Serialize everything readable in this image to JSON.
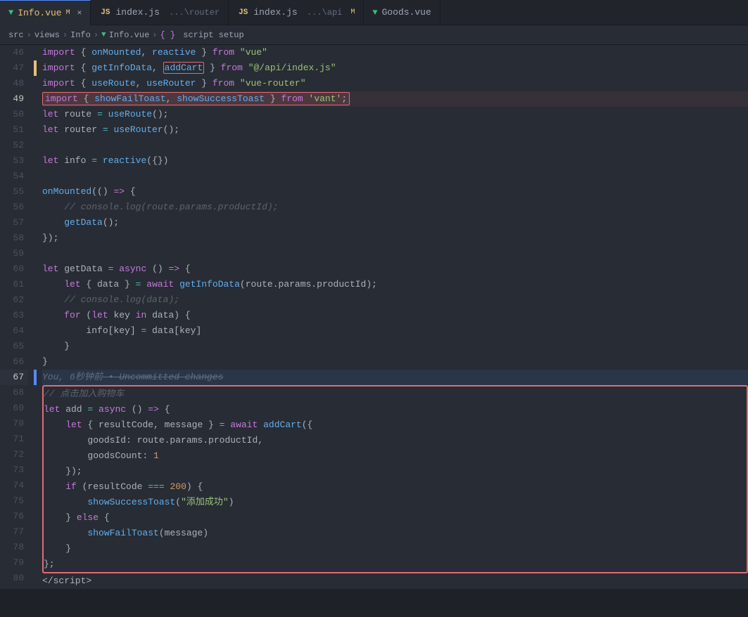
{
  "tabs": [
    {
      "id": "info-vue",
      "icon": "vue",
      "label": "Info.vue",
      "modified": true,
      "active": true,
      "close": true
    },
    {
      "id": "router-index",
      "icon": "js",
      "label": "index.js",
      "path": "...\\router",
      "active": false
    },
    {
      "id": "api-index",
      "icon": "js",
      "label": "index.js",
      "path": "...\\api",
      "modified": true,
      "active": false
    },
    {
      "id": "goods-vue",
      "icon": "vue",
      "label": "Goods.vue",
      "active": false
    }
  ],
  "breadcrumb": {
    "parts": [
      "src",
      "views",
      "Info",
      "Info.vue",
      "{ } script setup"
    ]
  },
  "lines": [
    {
      "num": 46,
      "git": "",
      "content": "46_import_onMounted"
    },
    {
      "num": 47,
      "git": "modified",
      "content": "47_import_getInfoData"
    },
    {
      "num": 48,
      "git": "",
      "content": "48_import_useRoute"
    },
    {
      "num": 49,
      "git": "",
      "content": "49_import_showFail",
      "highlight": true
    },
    {
      "num": 50,
      "git": "",
      "content": "50_let_route"
    },
    {
      "num": 51,
      "git": "",
      "content": "51_let_router"
    },
    {
      "num": 52,
      "git": "",
      "content": "52_blank"
    },
    {
      "num": 53,
      "git": "",
      "content": "53_let_info"
    },
    {
      "num": 54,
      "git": "",
      "content": "54_blank"
    },
    {
      "num": 55,
      "git": "",
      "content": "55_onMounted"
    },
    {
      "num": 56,
      "git": "",
      "content": "56_console_log"
    },
    {
      "num": 57,
      "git": "",
      "content": "57_getData"
    },
    {
      "num": 58,
      "git": "",
      "content": "58_close_mounted"
    },
    {
      "num": 59,
      "git": "",
      "content": "59_blank"
    },
    {
      "num": 60,
      "git": "",
      "content": "60_let_getData"
    },
    {
      "num": 61,
      "git": "",
      "content": "61_let_data"
    },
    {
      "num": 62,
      "git": "",
      "content": "62_console_log_data"
    },
    {
      "num": 63,
      "git": "",
      "content": "63_for_let"
    },
    {
      "num": 64,
      "git": "",
      "content": "64_info_key"
    },
    {
      "num": 65,
      "git": "",
      "content": "65_close_brace"
    },
    {
      "num": 66,
      "git": "",
      "content": "66_close_brace2"
    },
    {
      "num": 67,
      "git": "blue",
      "content": "67_you_uncommitted"
    },
    {
      "num": 68,
      "git": "",
      "content": "68_comment_add_cart",
      "redBorder": true
    },
    {
      "num": 69,
      "git": "",
      "content": "69_let_add",
      "redBorder": true
    },
    {
      "num": 70,
      "git": "",
      "content": "70_let_result",
      "redBorder": true
    },
    {
      "num": 71,
      "git": "",
      "content": "71_goodsId",
      "redBorder": true
    },
    {
      "num": 72,
      "git": "",
      "content": "72_goodsCount",
      "redBorder": true
    },
    {
      "num": 73,
      "git": "",
      "content": "73_close_obj",
      "redBorder": true
    },
    {
      "num": 74,
      "git": "",
      "content": "74_if_resultCode",
      "redBorder": true
    },
    {
      "num": 75,
      "git": "",
      "content": "75_showSuccessToast",
      "redBorder": true
    },
    {
      "num": 76,
      "git": "",
      "content": "76_else",
      "redBorder": true
    },
    {
      "num": 77,
      "git": "",
      "content": "77_showFailToast",
      "redBorder": true
    },
    {
      "num": 78,
      "git": "",
      "content": "78_close_else",
      "redBorder": true
    },
    {
      "num": 79,
      "git": "",
      "content": "79_close_fn",
      "redBorder": true
    },
    {
      "num": 80,
      "git": "",
      "content": "80_script_close"
    }
  ]
}
